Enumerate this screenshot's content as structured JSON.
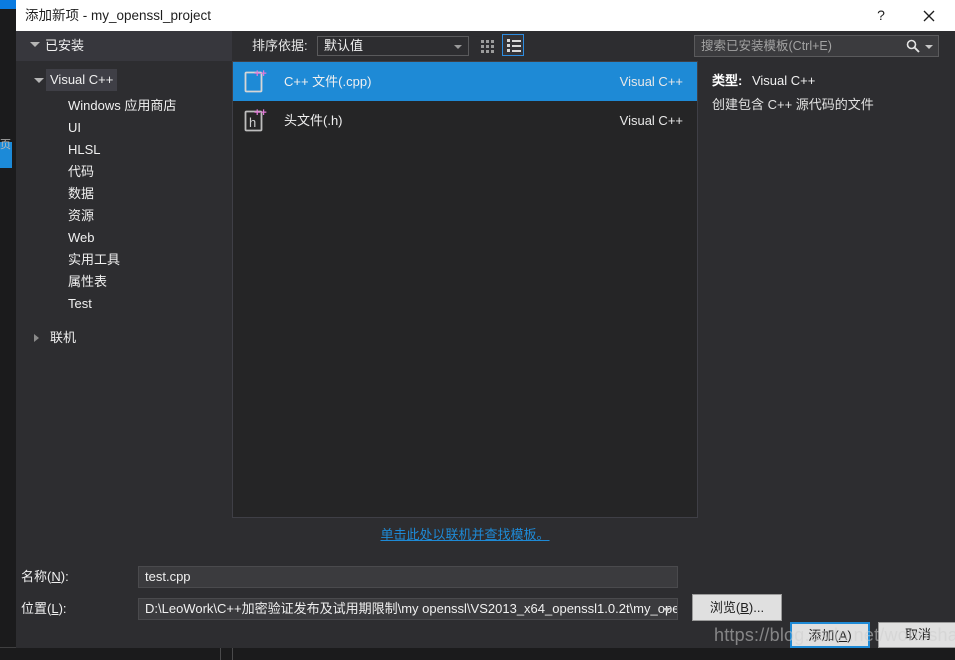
{
  "window": {
    "title": "添加新项 - my_openssl_project",
    "help_label": "?",
    "close_label": "✕"
  },
  "toolbar": {
    "installed_label": "已安装",
    "sort_by_label": "排序依据:",
    "sort_by_value": "默认值",
    "grid_view_icon": "grid-view-icon",
    "list_view_icon": "list-view-icon",
    "search_placeholder": "搜索已安装模板(Ctrl+E)",
    "search_icon": "search-icon",
    "accent_color": "#1e8ad6"
  },
  "tree": {
    "root": {
      "label": "Visual C++",
      "selected": true
    },
    "children": [
      {
        "label": "Windows 应用商店"
      },
      {
        "label": "UI"
      },
      {
        "label": "HLSL"
      },
      {
        "label": "代码"
      },
      {
        "label": "数据"
      },
      {
        "label": "资源"
      },
      {
        "label": "Web"
      },
      {
        "label": "实用工具"
      },
      {
        "label": "属性表"
      },
      {
        "label": "Test"
      }
    ],
    "online_node": {
      "label": "联机"
    }
  },
  "templates": {
    "items": [
      {
        "name": "C++ 文件(.cpp)",
        "category": "Visual C++",
        "icon": "cpp-file-icon",
        "selected": true
      },
      {
        "name": "头文件(.h)",
        "category": "Visual C++",
        "icon": "header-file-icon",
        "selected": false
      }
    ],
    "online_link": "单击此处以联机并查找模板。"
  },
  "detail": {
    "type_key": "类型:",
    "type_value": "Visual C++",
    "description": "创建包含 C++ 源代码的文件"
  },
  "form": {
    "name_label_pre": "名称(",
    "name_label_key": "N",
    "name_label_post": "):",
    "name_value": "test.cpp",
    "location_label_pre": "位置(",
    "location_label_key": "L",
    "location_label_post": "):",
    "location_value": "D:\\LeoWork\\C++加密验证发布及试用期限制\\my openssl\\VS2013_x64_openssl1.0.2t\\my_ope",
    "browse_pre": "浏览(",
    "browse_key": "B",
    "browse_post": ")...",
    "add_pre": "添加(",
    "add_key": "A",
    "add_post": ")",
    "cancel_label": "取消"
  },
  "background": {
    "tab_label": "页"
  },
  "watermark": {
    "text": "https://blog.csdn.net/wonosharp"
  }
}
